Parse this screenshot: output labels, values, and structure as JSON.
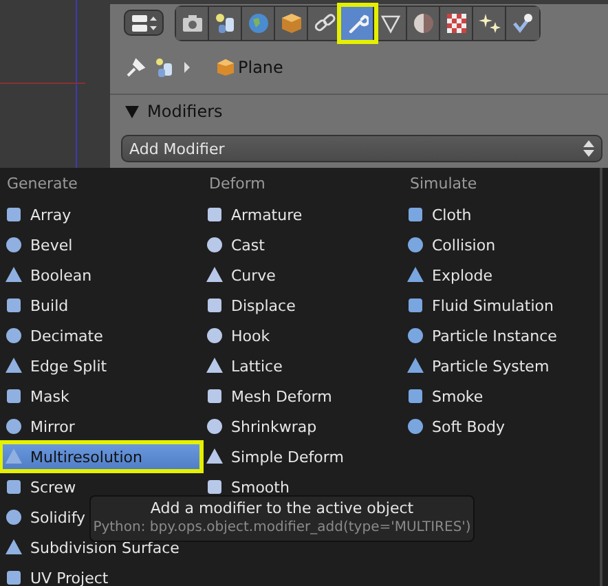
{
  "properties": {
    "tabs": [
      {
        "selected": false
      },
      {
        "selected": false
      },
      {
        "selected": false
      },
      {
        "selected": false
      },
      {
        "selected": false
      },
      {
        "selected": true
      },
      {
        "selected": false
      },
      {
        "selected": false
      },
      {
        "selected": false
      },
      {
        "selected": false
      },
      {
        "selected": false
      }
    ],
    "breadcrumb": {
      "object": "Plane"
    },
    "panel": {
      "title": "Modifiers",
      "expanded": true
    },
    "dropdown": {
      "label": "Add Modifier"
    }
  },
  "menu": {
    "columns": [
      {
        "heading": "Generate",
        "items": [
          {
            "label": "Array",
            "selected": false
          },
          {
            "label": "Bevel",
            "selected": false
          },
          {
            "label": "Boolean",
            "selected": false
          },
          {
            "label": "Build",
            "selected": false
          },
          {
            "label": "Decimate",
            "selected": false
          },
          {
            "label": "Edge Split",
            "selected": false
          },
          {
            "label": "Mask",
            "selected": false
          },
          {
            "label": "Mirror",
            "selected": false
          },
          {
            "label": "Multiresolution",
            "selected": true
          },
          {
            "label": "Screw",
            "selected": false
          },
          {
            "label": "Solidify",
            "selected": false
          },
          {
            "label": "Subdivision Surface",
            "selected": false
          },
          {
            "label": "UV Project",
            "selected": false
          }
        ]
      },
      {
        "heading": "Deform",
        "items": [
          {
            "label": "Armature",
            "selected": false
          },
          {
            "label": "Cast",
            "selected": false
          },
          {
            "label": "Curve",
            "selected": false
          },
          {
            "label": "Displace",
            "selected": false
          },
          {
            "label": "Hook",
            "selected": false
          },
          {
            "label": "Lattice",
            "selected": false
          },
          {
            "label": "Mesh Deform",
            "selected": false
          },
          {
            "label": "Shrinkwrap",
            "selected": false
          },
          {
            "label": "Simple Deform",
            "selected": false
          },
          {
            "label": "Smooth",
            "selected": false
          }
        ]
      },
      {
        "heading": "Simulate",
        "items": [
          {
            "label": "Cloth",
            "selected": false
          },
          {
            "label": "Collision",
            "selected": false
          },
          {
            "label": "Explode",
            "selected": false
          },
          {
            "label": "Fluid Simulation",
            "selected": false
          },
          {
            "label": "Particle Instance",
            "selected": false
          },
          {
            "label": "Particle System",
            "selected": false
          },
          {
            "label": "Smoke",
            "selected": false
          },
          {
            "label": "Soft Body",
            "selected": false
          }
        ]
      }
    ]
  },
  "tooltip": {
    "text": "Add a modifier to the active object",
    "python": "Python: bpy.ops.object.modifier_add(type='MULTIRES')"
  }
}
